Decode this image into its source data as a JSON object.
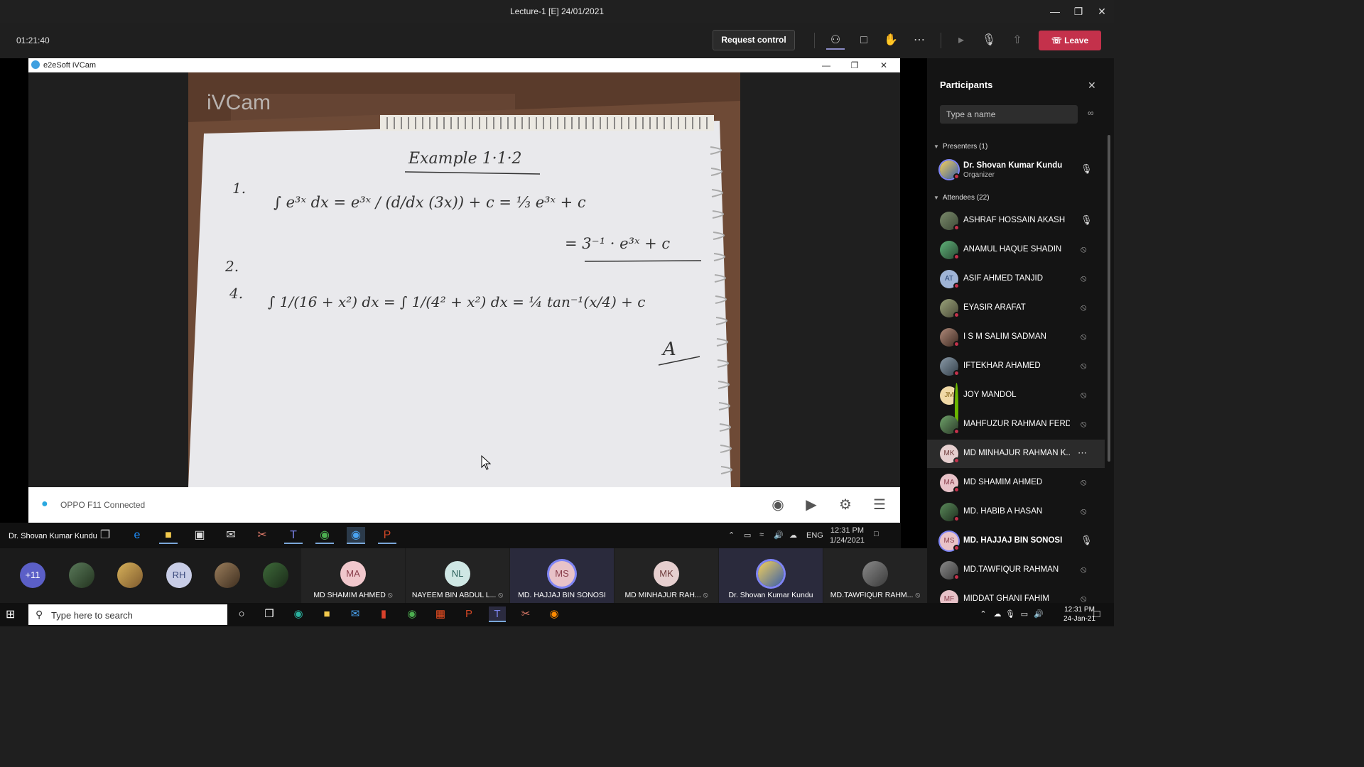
{
  "window": {
    "title": "Lecture-1 [E] 24/01/2021"
  },
  "meeting": {
    "timer": "01:21:40",
    "request_control": "Request control",
    "leave": "Leave"
  },
  "ivcam": {
    "title": "e2eSoft iVCam",
    "status": "OPPO F11 Connected",
    "watermark": "iVCam"
  },
  "notes": {
    "heading": "Example 1·1·2",
    "l1_num": "1.",
    "l1": "∫ e³ˣ dx = e³ˣ / (d/dx (3x)) + c = ⅓ e³ˣ + c",
    "l1b": "= 3⁻¹ · e³ˣ + c",
    "l2_num": "2.",
    "l4_num": "4.",
    "l4": "∫ 1/(16 + x²) dx = ∫ 1/(4² + x²) dx = ¼ tan⁻¹(x/4) + c",
    "ans": "A"
  },
  "share_taskbar": {
    "presenter": "Dr. Shovan Kumar Kundu",
    "time": "12:31 PM",
    "date": "1/24/2021",
    "lang": "ENG"
  },
  "participants": {
    "title": "Participants",
    "search_placeholder": "Type a name",
    "presenters_label": "Presenters (1)",
    "attendees_label": "Attendees (22)",
    "presenter": {
      "name": "Dr. Shovan Kumar Kundu",
      "role": "Organizer"
    },
    "attendees": [
      {
        "name": "ASHRAF HOSSAIN AKASH",
        "initials": ""
      },
      {
        "name": "ANAMUL HAQUE SHADIN",
        "initials": ""
      },
      {
        "name": "ASIF AHMED TANJID",
        "initials": "AT"
      },
      {
        "name": "EYASIR ARAFAT",
        "initials": ""
      },
      {
        "name": "I S M SALIM SADMAN",
        "initials": ""
      },
      {
        "name": "IFTEKHAR AHAMED",
        "initials": ""
      },
      {
        "name": "JOY MANDOL",
        "initials": "JM"
      },
      {
        "name": "MAHFUZUR RAHMAN FERDO...",
        "initials": ""
      },
      {
        "name": "MD MINHAJUR RAHMAN K...",
        "initials": "MK"
      },
      {
        "name": "MD SHAMIM AHMED",
        "initials": "MA"
      },
      {
        "name": "MD. HABIB A HASAN",
        "initials": ""
      },
      {
        "name": "MD. HAJJAJ BIN SONOSI",
        "initials": "MS"
      },
      {
        "name": "MD.TAWFIQUR RAHMAN",
        "initials": ""
      },
      {
        "name": "MIDDAT GHANI FAHIM",
        "initials": "MF"
      }
    ]
  },
  "gallery": {
    "more": "+11",
    "rh": "RH",
    "tiles": [
      {
        "initials": "MA",
        "name": "MD SHAMIM AHMED"
      },
      {
        "initials": "NL",
        "name": "NAYEEM BIN ABDUL L..."
      },
      {
        "initials": "MS",
        "name": "MD. HAJJAJ BIN SONOSI"
      },
      {
        "initials": "MK",
        "name": "MD MINHAJUR RAH..."
      },
      {
        "initials": "",
        "name": "Dr. Shovan Kumar Kundu"
      },
      {
        "initials": "",
        "name": "MD.TAWFIQUR RAHM..."
      }
    ]
  },
  "taskbar": {
    "search_placeholder": "Type here to search",
    "time": "12:31 PM",
    "date": "24-Jan-21"
  }
}
